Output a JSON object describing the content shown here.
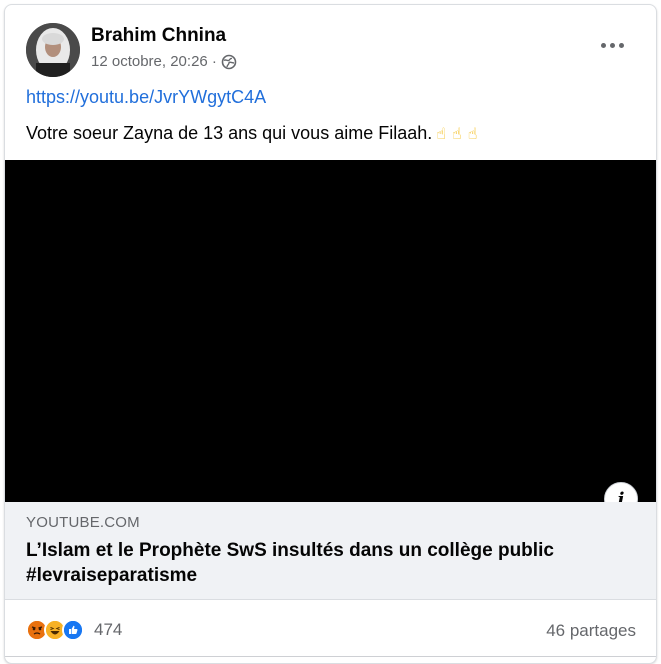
{
  "post": {
    "author": "Brahim Chnina",
    "timestamp": "12 octobre, 20:26 ·",
    "visibility_icon": "globe-icon",
    "link_text": "https://youtu.be/JvrYWgytC4A",
    "text": "Votre soeur Zayna de 13 ans qui vous aime Filaah.",
    "emojis": [
      "point-up-hand",
      "point-up-hand",
      "point-up-hand"
    ]
  },
  "preview": {
    "domain": "YOUTUBE.COM",
    "title": "L’Islam et le Prophète SwS insultés dans un collège public #levraiseparatisme"
  },
  "engagement": {
    "reaction_icons": [
      "angry",
      "haha",
      "like"
    ],
    "reaction_count": "474",
    "shares": "46 partages"
  },
  "colors": {
    "link": "#216fdb",
    "meta": "#65676b",
    "like": "#1877f2",
    "angry": "#e9710f",
    "haha": "#f7b125"
  }
}
